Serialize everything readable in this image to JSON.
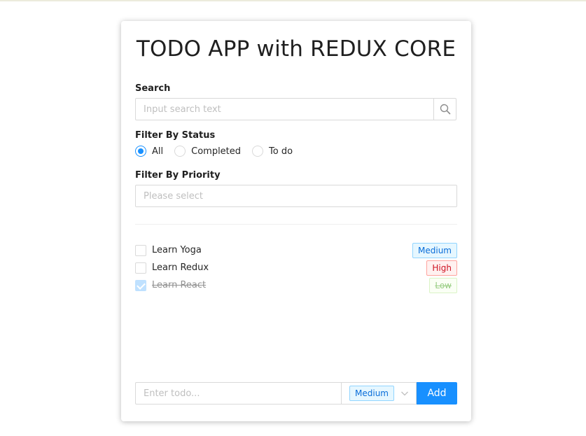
{
  "app": {
    "title": "TODO APP with REDUX CORE"
  },
  "search": {
    "label": "Search",
    "placeholder": "Input search text",
    "icon": "search-icon"
  },
  "status_filter": {
    "label": "Filter By Status",
    "options": [
      "All",
      "Completed",
      "To do"
    ],
    "selected": "All",
    "accent": "#1890ff"
  },
  "priority_filter": {
    "label": "Filter By Priority",
    "placeholder": "Please select"
  },
  "todos": [
    {
      "text": "Learn Yoga",
      "priority": "Medium",
      "completed": false
    },
    {
      "text": "Learn Redux",
      "priority": "High",
      "completed": false
    },
    {
      "text": "Learn React",
      "priority": "Low",
      "completed": true
    }
  ],
  "add_form": {
    "placeholder": "Enter todo...",
    "priority_value": "Medium",
    "add_label": "Add",
    "button_color": "#1890ff"
  }
}
